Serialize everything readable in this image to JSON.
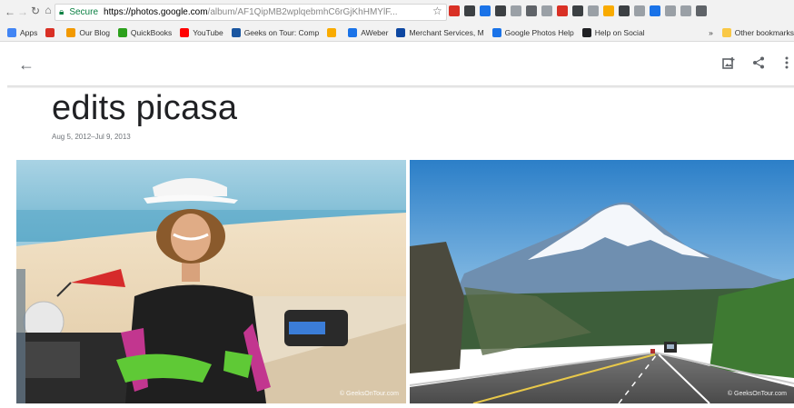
{
  "browser": {
    "url_secure_label": "Secure",
    "url_host": "https://photos.google.com",
    "url_path": "/album/AF1QipMB2wplqebmhC6rGjKhHMYlF...",
    "extension_colors": [
      "#d93025",
      "#3c4043",
      "#1a73e8",
      "#3c4043",
      "#9aa0a6",
      "#5f6368",
      "#9aa0a6",
      "#d93025",
      "#3c4043",
      "#9aa0a6",
      "#f9ab00",
      "#3c4043",
      "#9aa0a6",
      "#1a73e8",
      "#9aa0a6",
      "#9aa0a6",
      "#5f6368"
    ]
  },
  "bookmarks": {
    "items": [
      {
        "label": "Apps",
        "color": "#4285f4"
      },
      {
        "label": "",
        "color": "#d93025"
      },
      {
        "label": "Our Blog",
        "color": "#f29900"
      },
      {
        "label": "QuickBooks",
        "color": "#2ca01c"
      },
      {
        "label": "YouTube",
        "color": "#ff0000"
      },
      {
        "label": "Geeks on Tour: Comp",
        "color": "#1a56a0"
      },
      {
        "label": "",
        "color": "#f9ab00"
      },
      {
        "label": "AWeber",
        "color": "#1a73e8"
      },
      {
        "label": "Merchant Services, M",
        "color": "#0d47a1"
      },
      {
        "label": "Google Photos Help",
        "color": "#1a73e8"
      },
      {
        "label": "Help on Social",
        "color": "#202124"
      }
    ],
    "overflow": "»",
    "other": "Other bookmarks"
  },
  "album": {
    "title": "edits picasa",
    "date_range": "Aug 5, 2012–Jul 9, 2013"
  },
  "photos": [
    {
      "watermark": "© GeeksOnTour.com"
    },
    {
      "watermark": "© GeeksOnTour.com"
    }
  ]
}
